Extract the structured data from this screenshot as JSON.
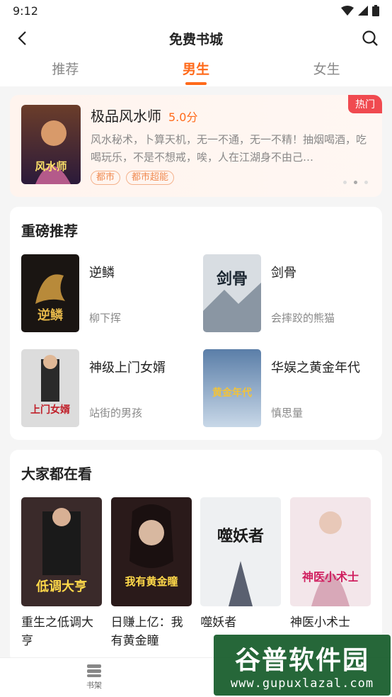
{
  "status": {
    "time": "9:12"
  },
  "header": {
    "title": "免费书城"
  },
  "tabs": [
    {
      "label": "推荐"
    },
    {
      "label": "男生"
    },
    {
      "label": "女生"
    }
  ],
  "banner": {
    "badge": "热门",
    "name": "极品风水师",
    "score": "5.0分",
    "desc": "风水秘术，卜算天机，无一不通，无一不精！抽烟喝酒，吃喝玩乐，不是不想戒，唉，人在江湖身不由己…",
    "tags": [
      "都市",
      "都市超能"
    ],
    "cover_text": "风水师",
    "page_index": 2,
    "page_count": 3
  },
  "featured": {
    "title": "重磅推荐",
    "books": [
      {
        "name": "逆鳞",
        "author": "柳下挥",
        "cover_text": "逆鳞"
      },
      {
        "name": "剑骨",
        "author": "会摔跤的熊猫",
        "cover_text": "剑骨"
      },
      {
        "name": "神级上门女婿",
        "author": "站街的男孩",
        "cover_text": "上门女婿"
      },
      {
        "name": "华娱之黄金年代",
        "author": "慎思量",
        "cover_text": "黄金年代"
      }
    ]
  },
  "popular": {
    "title": "大家都在看",
    "books": [
      {
        "name": "重生之低调大亨",
        "cover_text": "低调大亨"
      },
      {
        "name": "日赚上亿：我有黄金瞳",
        "cover_text": "我有黄金瞳"
      },
      {
        "name": "噬妖者",
        "cover_text": "噬妖者"
      },
      {
        "name": "神医小术士",
        "cover_text": "神医小术士"
      }
    ]
  },
  "bottom_nav": {
    "shelf_label": "书架"
  },
  "watermark": {
    "cn": "谷普软件园",
    "url": "www.gupuxlazal.com"
  }
}
